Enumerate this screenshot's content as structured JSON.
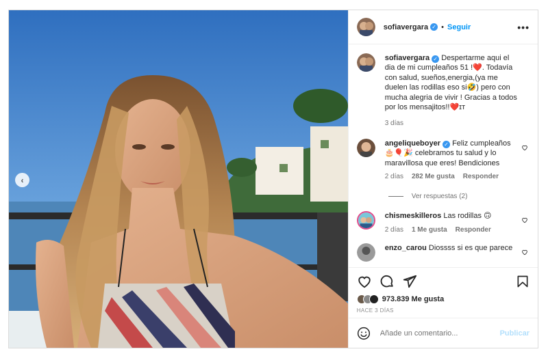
{
  "post": {
    "author": {
      "username": "sofiavergara",
      "verified": true,
      "follow_label": "Seguir",
      "separator": "•"
    },
    "more_options_icon": "more-horizontal-icon",
    "carousel_prev_icon": "chevron-left-icon",
    "caption": {
      "username": "sofiavergara",
      "text": "Despertarme aqui el dia de mi cumpleaños 51 !❤️. Todavía con salud, sueños,energia,(ya me duelen las rodillas eso si🤣) pero con mucha alegria de vivir ! Gracias a todos por los mensajitos!!❤️ɪᴛ",
      "time": "3 días"
    },
    "comments": [
      {
        "username": "angeliqueboyer",
        "verified": true,
        "text": "Feliz cumpleaños 🎂🎈🎉 celebramos tu salud y lo maravillosa que eres! Bendiciones",
        "time": "2 días",
        "likes": "282 Me gusta",
        "reply_label": "Responder",
        "view_replies": "Ver respuestas (2)"
      },
      {
        "username": "chismeskilleros",
        "verified": false,
        "text": "Las rodillas 🙃",
        "time": "2 días",
        "likes": "1 Me gusta",
        "reply_label": "Responder"
      },
      {
        "username": "enzo_carou",
        "verified": false,
        "text": "Diossss si es que parece",
        "time": "",
        "likes": "",
        "reply_label": ""
      }
    ],
    "action_icons": [
      "heart-icon",
      "comment-icon",
      "share-icon",
      "bookmark-icon"
    ],
    "likes_count": "973.839 Me gusta",
    "time_ago": "HACE 3 DÍAS",
    "add_comment": {
      "placeholder": "Añade un comentario...",
      "publish_label": "Publicar",
      "emoji_icon": "emoji-icon"
    }
  },
  "colors": {
    "link_blue": "#0095f6",
    "verified_blue": "#3897f0",
    "heart_red": "#ed4956",
    "publish_disabled": "#b2dffc"
  }
}
